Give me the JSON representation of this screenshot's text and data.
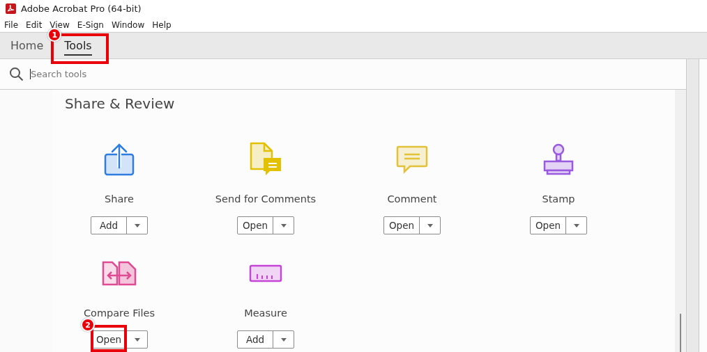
{
  "window": {
    "title": "Adobe Acrobat Pro (64-bit)"
  },
  "menu": [
    "File",
    "Edit",
    "View",
    "E-Sign",
    "Window",
    "Help"
  ],
  "tabs": [
    {
      "label": "Home",
      "selected": false
    },
    {
      "label": "Tools",
      "selected": true,
      "callout": "1"
    }
  ],
  "search": {
    "placeholder": "Search tools"
  },
  "section": {
    "title": "Share & Review",
    "tools": [
      {
        "name": "Share",
        "kind": "share",
        "button": "Add"
      },
      {
        "name": "Send for Comments",
        "kind": "send",
        "button": "Open"
      },
      {
        "name": "Comment",
        "kind": "comment",
        "button": "Open"
      },
      {
        "name": "Stamp",
        "kind": "stamp",
        "button": "Open"
      },
      {
        "name": "Compare Files",
        "kind": "compare",
        "button": "Open",
        "callout": "2"
      },
      {
        "name": "Measure",
        "kind": "measure",
        "button": "Add"
      }
    ]
  }
}
